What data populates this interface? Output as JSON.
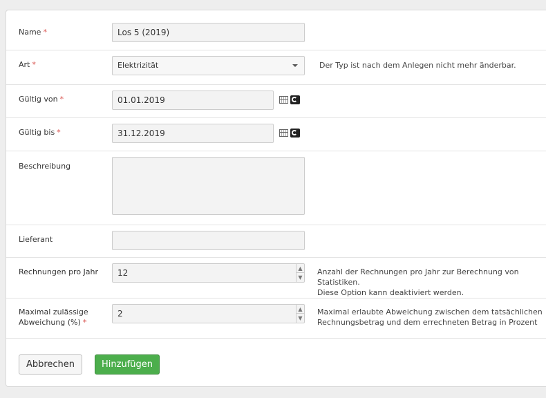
{
  "form": {
    "name": {
      "label": "Name",
      "required": "*",
      "value": "Los 5 (2019)"
    },
    "art": {
      "label": "Art",
      "required": "*",
      "value": "Elektrizität",
      "help": "Der Typ ist nach dem Anlegen nicht mehr änderbar."
    },
    "valid_from": {
      "label": "Gültig von",
      "required": "*",
      "value": "01.01.2019"
    },
    "valid_to": {
      "label": "Gültig bis",
      "required": "*",
      "value": "31.12.2019"
    },
    "description": {
      "label": "Beschreibung",
      "value": ""
    },
    "supplier": {
      "label": "Lieferant",
      "value": ""
    },
    "invoices_per_year": {
      "label": "Rechnungen pro Jahr",
      "value": "12",
      "help_line1": "Anzahl der Rechnungen pro Jahr zur Berechnung von Statistiken.",
      "help_line2": "Diese Option kann deaktiviert werden."
    },
    "max_deviation": {
      "label_line1": "Maximal zulässige",
      "label_line2": "Abweichung (%)",
      "required": "*",
      "value": "2",
      "help_line1": "Maximal erlaubte Abweichung zwischen dem tatsächlichen",
      "help_line2": "Rechnungsbetrag und dem errechneten Betrag in Prozent"
    }
  },
  "actions": {
    "cancel_label": "Abbrechen",
    "add_label": "Hinzufügen"
  },
  "icons": {
    "calendar": "calendar-icon",
    "clear": "clear-icon",
    "spin_up": "chevron-up-icon",
    "spin_down": "chevron-down-icon",
    "select": "caret-down-icon"
  },
  "colors": {
    "required": "#d9534f",
    "primary_button": "#4cae4c"
  }
}
